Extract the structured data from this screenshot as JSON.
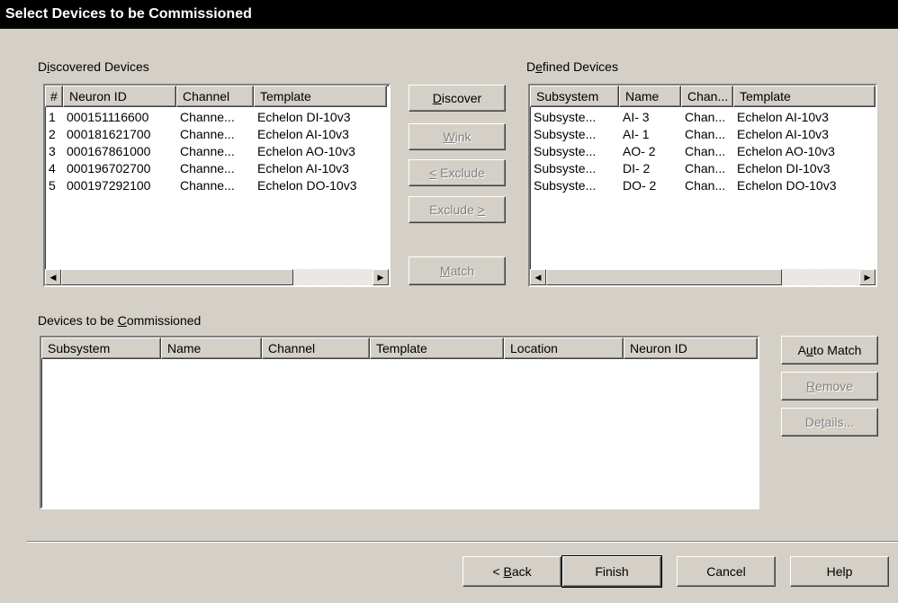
{
  "window": {
    "title": "Select Devices to be Commissioned"
  },
  "discovered": {
    "label_pre": "D",
    "label_acc": "i",
    "label_post": "scovered Devices",
    "columns": [
      "#",
      "Neuron ID",
      "Channel",
      "Template"
    ],
    "rows": [
      [
        "1",
        "000151116600",
        "Channe...",
        "Echelon DI-10v3"
      ],
      [
        "2",
        "000181621700",
        "Channe...",
        "Echelon AI-10v3"
      ],
      [
        "3",
        "000167861000",
        "Channe...",
        "Echelon AO-10v3"
      ],
      [
        "4",
        "000196702700",
        "Channe...",
        "Echelon AI-10v3"
      ],
      [
        "5",
        "000197292100",
        "Channe...",
        "Echelon DO-10v3"
      ]
    ]
  },
  "defined": {
    "label_pre": "D",
    "label_acc": "e",
    "label_post": "fined Devices",
    "columns": [
      "Subsystem",
      "Name",
      "Chan...",
      "Template"
    ],
    "rows": [
      [
        "Subsyste...",
        "AI- 3",
        "Chan...",
        "Echelon AI-10v3"
      ],
      [
        "Subsyste...",
        "AI- 1",
        "Chan...",
        "Echelon AI-10v3"
      ],
      [
        "Subsyste...",
        "AO- 2",
        "Chan...",
        "Echelon AO-10v3"
      ],
      [
        "Subsyste...",
        "DI- 2",
        "Chan...",
        "Echelon DI-10v3"
      ],
      [
        "Subsyste...",
        "DO- 2",
        "Chan...",
        "Echelon DO-10v3"
      ]
    ]
  },
  "middle_buttons": {
    "discover_acc": "D",
    "discover_post": "iscover",
    "wink_acc": "W",
    "wink_post": "ink",
    "exclude_left_acc": "<",
    "exclude_left_post": " Exclude",
    "exclude_right_pre": "Exclude ",
    "exclude_right_acc": ">",
    "match_acc": "M",
    "match_post": "atch"
  },
  "commission": {
    "label_pre": "Devices to be ",
    "label_acc": "C",
    "label_post": "ommissioned",
    "columns": [
      "Subsystem",
      "Name",
      "Channel",
      "Template",
      "Location",
      "Neuron ID"
    ]
  },
  "side_buttons": {
    "auto_pre": "A",
    "auto_acc": "u",
    "auto_post": "to Match",
    "remove_acc": "R",
    "remove_post": "emove",
    "details_pre": "De",
    "details_acc": "t",
    "details_post": "ails..."
  },
  "footer": {
    "back_pre": "< ",
    "back_acc": "B",
    "back_post": "ack",
    "finish": "Finish",
    "cancel": "Cancel",
    "help": "Help"
  }
}
